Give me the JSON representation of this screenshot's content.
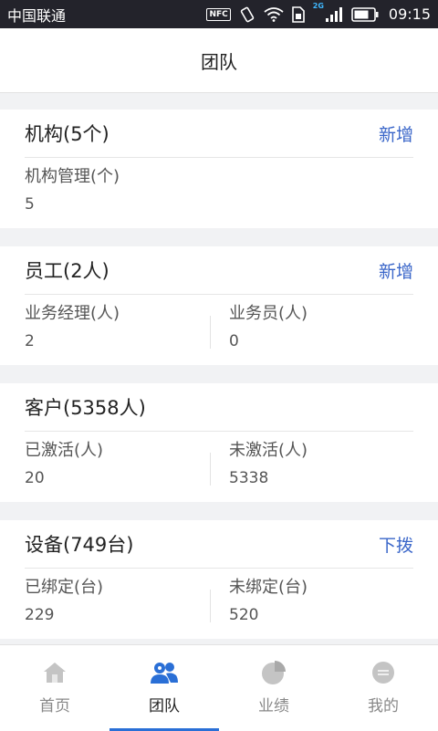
{
  "status_bar": {
    "carrier": "中国联通",
    "nfc": "NFC",
    "network": "2G",
    "time": "09:15"
  },
  "header": {
    "title": "团队"
  },
  "sections": [
    {
      "title": "机构(5个)",
      "action": "新增",
      "stats": [
        {
          "label": "机构管理(个)",
          "value": "5"
        }
      ]
    },
    {
      "title": "员工(2人)",
      "action": "新增",
      "stats": [
        {
          "label": "业务经理(人)",
          "value": "2"
        },
        {
          "label": "业务员(人)",
          "value": "0"
        }
      ]
    },
    {
      "title": "客户(5358人)",
      "stats": [
        {
          "label": "已激活(人)",
          "value": "20"
        },
        {
          "label": "未激活(人)",
          "value": "5338"
        }
      ]
    },
    {
      "title": "设备(749台)",
      "action": "下拨",
      "stats": [
        {
          "label": "已绑定(台)",
          "value": "229"
        },
        {
          "label": "未绑定(台)",
          "value": "520"
        }
      ]
    }
  ],
  "bottom_nav": {
    "active_index": 1,
    "items": [
      {
        "label": "首页",
        "icon": "home-icon"
      },
      {
        "label": "团队",
        "icon": "team-icon"
      },
      {
        "label": "业绩",
        "icon": "pie-chart-icon"
      },
      {
        "label": "我的",
        "icon": "profile-icon"
      }
    ]
  },
  "colors": {
    "accent": "#2a6fd6",
    "action_link": "#3a66c9",
    "status_bar": "#23232b",
    "background": "#f1f2f4"
  }
}
